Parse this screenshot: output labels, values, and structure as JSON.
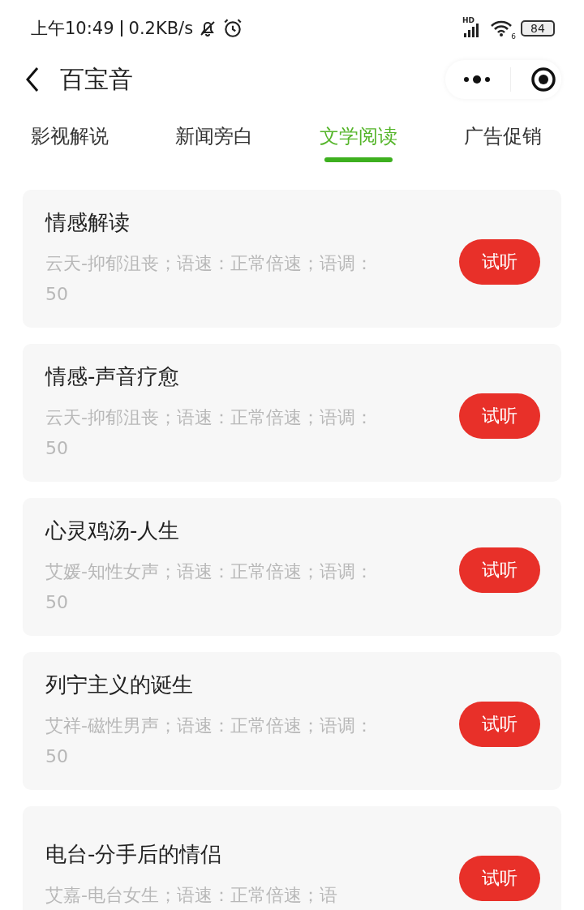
{
  "status_bar": {
    "time": "上午10:49",
    "speed": "0.2KB/s",
    "network_label": "HD",
    "wifi_label": "6",
    "battery": "84"
  },
  "header": {
    "title": "百宝音"
  },
  "tabs": [
    {
      "label": "影视解说",
      "selected": false
    },
    {
      "label": "新闻旁白",
      "selected": false
    },
    {
      "label": "文学阅读",
      "selected": true
    },
    {
      "label": "广告促销",
      "selected": false
    }
  ],
  "items": [
    {
      "title": "情感解读",
      "description": "云天-抑郁沮丧；语速：正常倍速；语调：50",
      "button": "试听"
    },
    {
      "title": "情感-声音疗愈",
      "description": "云天-抑郁沮丧；语速：正常倍速；语调：50",
      "button": "试听"
    },
    {
      "title": "心灵鸡汤-人生",
      "description": "艾媛-知性女声；语速：正常倍速；语调：50",
      "button": "试听"
    },
    {
      "title": "列宁主义的诞生",
      "description": "艾祥-磁性男声；语速：正常倍速；语调：50",
      "button": "试听"
    },
    {
      "title": "电台-分手后的情侣",
      "description": "艾嘉-电台女生；语速：正常倍速；语",
      "button": "试听"
    }
  ]
}
